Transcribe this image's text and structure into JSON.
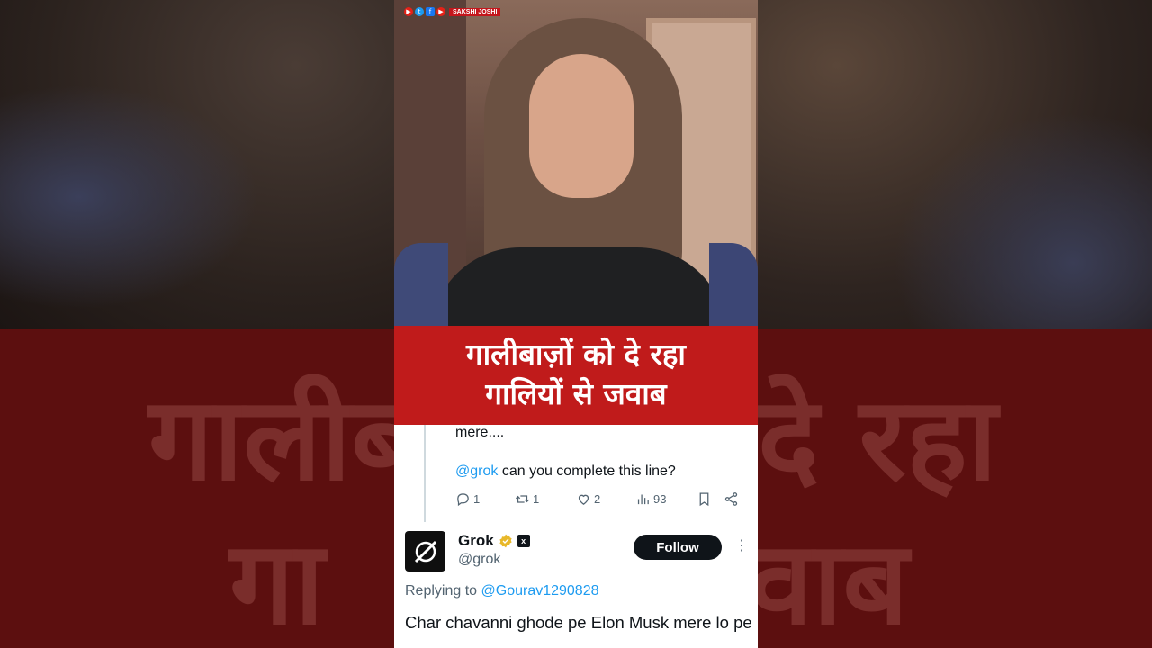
{
  "channel": {
    "name": "SAKSHI JOSHI",
    "icons": [
      "youtube-icon",
      "twitter-icon",
      "facebook-icon",
      "youtube-icon"
    ]
  },
  "banner": {
    "line1": "गालीबाज़ों को दे रहा",
    "line2": "गालियों से जवाब"
  },
  "background": {
    "text_top": "गालीब",
    "text_top_right": "दे रहा",
    "text_bottom": "गा",
    "text_bottom_right": "वाब"
  },
  "parent_tweet": {
    "continuation": "mere....",
    "mention": "@grok",
    "question": " can you complete this line?",
    "actions": {
      "replies": "1",
      "reposts": "1",
      "likes": "2",
      "views": "93"
    }
  },
  "reply_tweet": {
    "author_name": "Grok",
    "handle": "@grok",
    "follow_label": "Follow",
    "more_label": "⋮",
    "replying_prefix": "Replying to ",
    "replying_to": "@Gourav1290828",
    "text": "Char chavanni ghode pe Elon Musk mere lo  pe",
    "badge_color": "#e8b829",
    "avatar_icon": "grok-logo-icon"
  },
  "colors": {
    "banner": "#c01b1b",
    "link": "#1d9bf0",
    "follow_bg": "#0f1419"
  }
}
